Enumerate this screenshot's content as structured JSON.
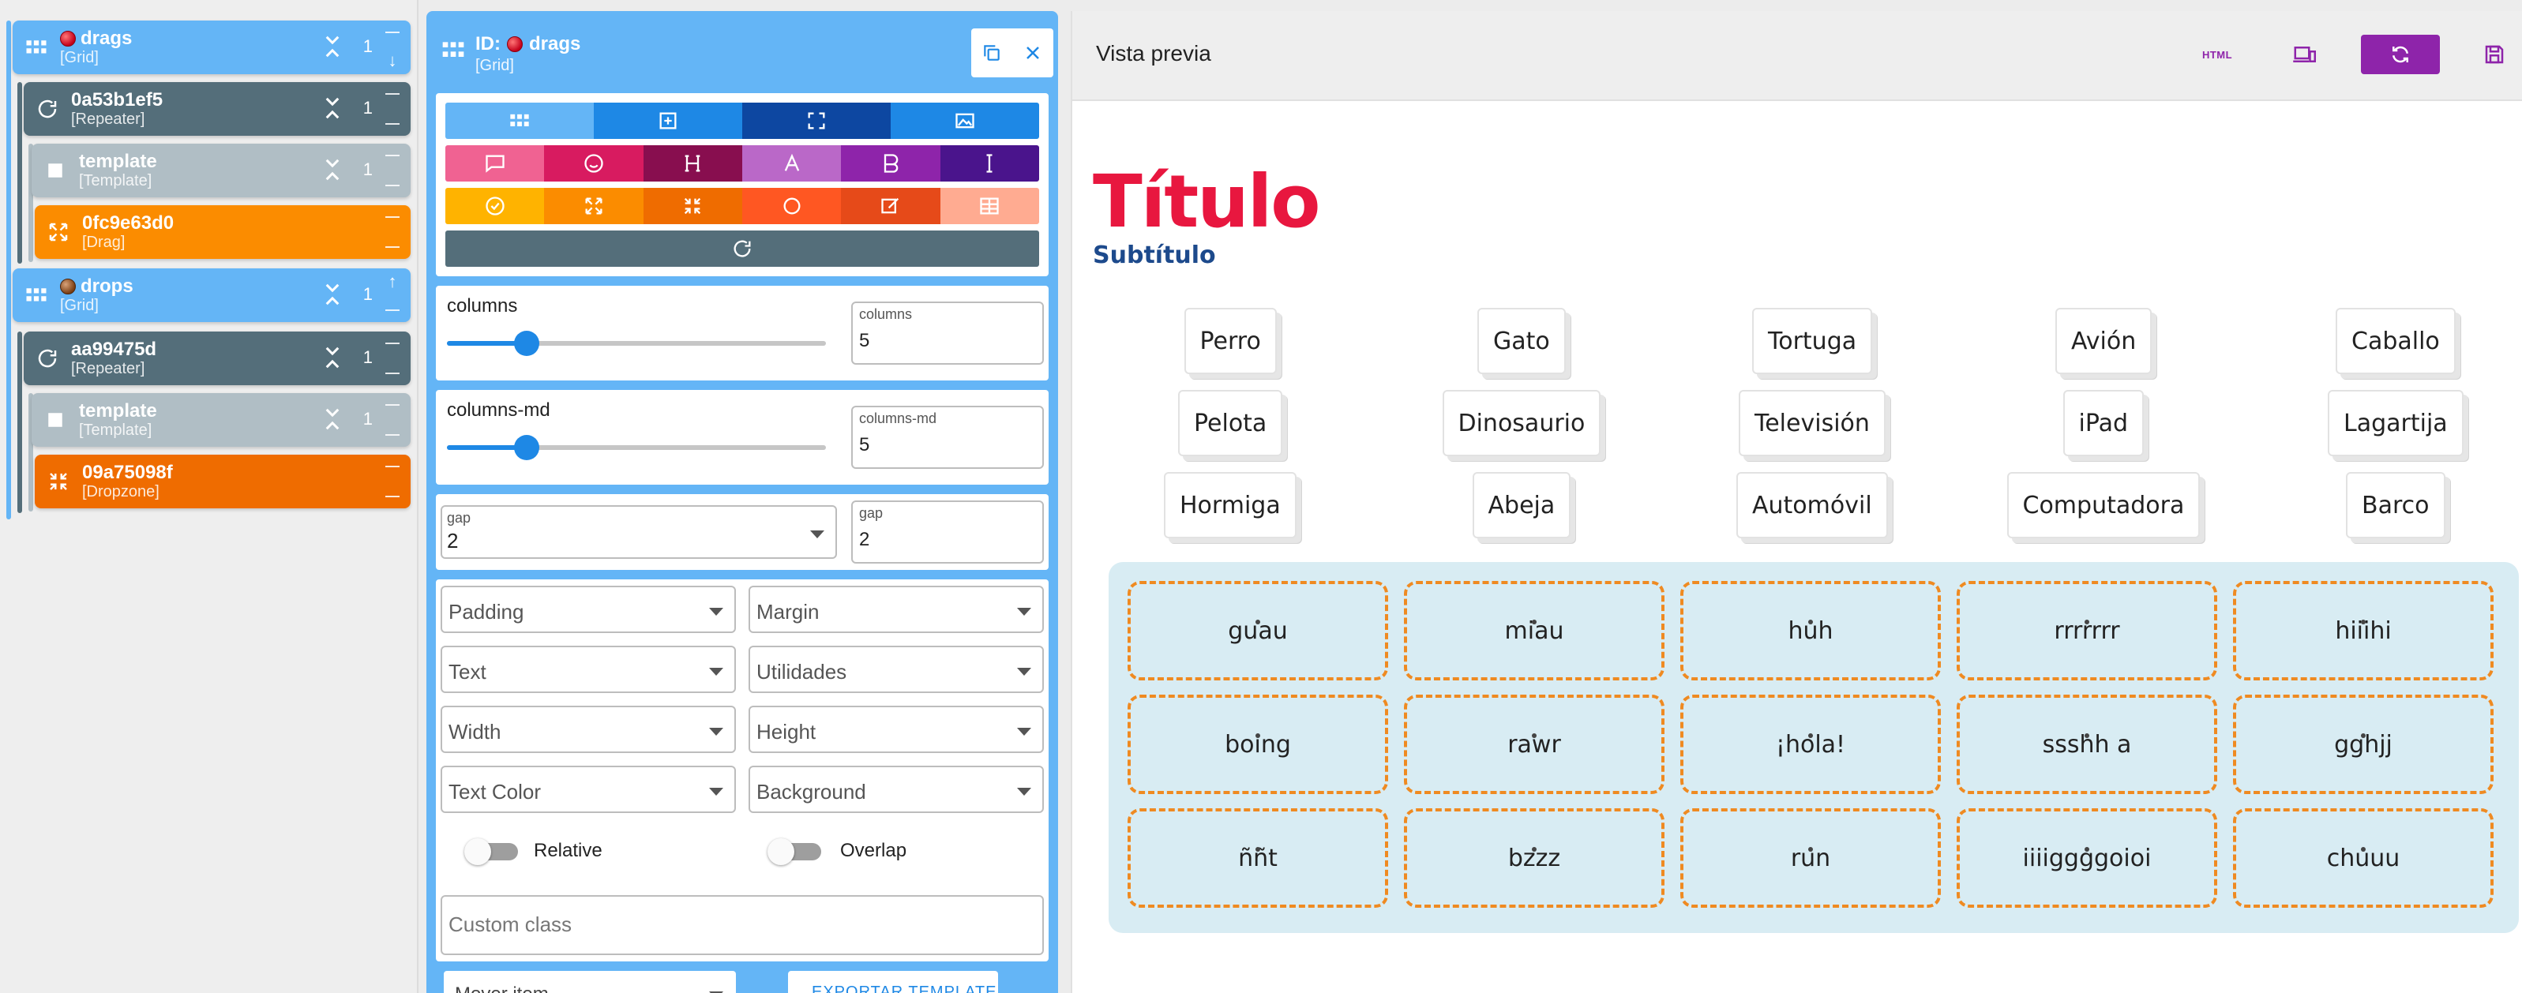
{
  "tree": {
    "nodes": [
      {
        "id": "drags",
        "type": "[Grid]",
        "count": "1",
        "color": "#64b5f6"
      },
      {
        "id": "0a53b1ef5",
        "type": "[Repeater]",
        "count": "1",
        "color": "#546e7a"
      },
      {
        "id": "template",
        "type": "[Template]",
        "count": "1",
        "color": "#b0bec5"
      },
      {
        "id": "0fc9e63d0",
        "type": "[Drag]",
        "count": "",
        "color": "#fb8c00"
      },
      {
        "id": "drops",
        "type": "[Grid]",
        "count": "1",
        "color": "#64b5f6"
      },
      {
        "id": "aa99475d",
        "type": "[Repeater]",
        "count": "1",
        "color": "#546e7a"
      },
      {
        "id": "template",
        "type": "[Template]",
        "count": "1",
        "color": "#b0bec5"
      },
      {
        "id": "09a75098f",
        "type": "[Dropzone]",
        "count": "",
        "color": "#ef6c00"
      }
    ]
  },
  "editor": {
    "id_label": "ID:",
    "id_value": "drags",
    "type": "[Grid]",
    "columns": {
      "label": "columns",
      "field_label": "columns",
      "value": "5",
      "slider_fraction": 0.21
    },
    "columns_md": {
      "label": "columns-md",
      "field_label": "columns-md",
      "value": "5",
      "slider_fraction": 0.21
    },
    "gap_select": {
      "label": "gap",
      "value": "2"
    },
    "gap_field": {
      "label": "gap",
      "value": "2"
    },
    "selects": [
      "Padding",
      "Margin",
      "Text",
      "Utilidades",
      "Width",
      "Height",
      "Text Color",
      "Background"
    ],
    "toggles": [
      "Relative",
      "Overlap"
    ],
    "custom_class_placeholder": "Custom class",
    "move_item": "Mover item",
    "export_template": "EXPORTAR TEMPLATE",
    "toolbar_colors": {
      "row1": [
        "#64b5f6",
        "#1e88e5",
        "#0d47a1",
        "#1e88e5"
      ],
      "row2": [
        "#f06292",
        "#d81b60",
        "#880e4f",
        "#ba68c8",
        "#8e24aa",
        "#4a148c"
      ],
      "row3": [
        "#ffb300",
        "#fb8c00",
        "#ef6c00",
        "#ff5722",
        "#e64a19",
        "#ffab91"
      ],
      "row4": [
        "#546e7a"
      ]
    }
  },
  "preview": {
    "title": "Vista previa",
    "html_label": "HTML",
    "heading": "Título",
    "subheading": "Subtítulo",
    "drag_items": [
      "Perro",
      "Gato",
      "Tortuga",
      "Avión",
      "Caballo",
      "Pelota",
      "Dinosaurio",
      "Televisión",
      "iPad",
      "Lagartija",
      "Hormiga",
      "Abeja",
      "Automóvil",
      "Computadora",
      "Barco"
    ],
    "drop_items": [
      "guau",
      "miau",
      "huh",
      "rrrrrrr",
      "hiiihi",
      "boing",
      "rawr",
      "¡hola!",
      "ssshh a",
      "gghjj",
      "ññt",
      "bzzz",
      "run",
      "iiiiggggoioi",
      "chuuu"
    ]
  }
}
